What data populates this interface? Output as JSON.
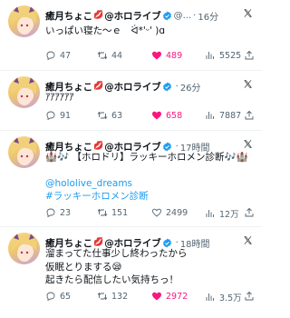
{
  "author": {
    "name": "癒月ちょこ",
    "org": "@ホロライブ",
    "lips": "💋"
  },
  "tweets": [
    {
      "handle": "@...",
      "time": "16分",
      "lines": [
        "いっぱい寝た〜ｅ　ᐛ*'ᵕ' )ɑ"
      ],
      "links": [],
      "replies": "47",
      "retweets": "44",
      "likes": "489",
      "views": "5525",
      "liked": true
    },
    {
      "handle": "",
      "time": "26分",
      "lines": [
        "ｱｱｱｱｱｱ"
      ],
      "links": [],
      "replies": "91",
      "retweets": "63",
      "likes": "658",
      "views": "7887",
      "liked": true
    },
    {
      "handle": "",
      "time": "17時間",
      "lines": [
        "🏰🎶 【ホロドリ】ラッキーホロメン診断🎶🏰"
      ],
      "links": [
        "@hololive_dreams",
        "#ラッキーホロメン診断"
      ],
      "replies": "23",
      "retweets": "151",
      "likes": "2499",
      "views": "12万",
      "liked": false
    },
    {
      "handle": "",
      "time": "18時間",
      "lines": [
        "溜まってた仕事少し終わったから",
        "仮眠とりまする😪",
        "起きたら配信したい気持ちっ！"
      ],
      "links": [],
      "replies": "65",
      "retweets": "132",
      "likes": "2972",
      "views": "3.5万",
      "liked": true
    }
  ],
  "icons": {
    "reply": "reply-icon",
    "retweet": "retweet-icon",
    "like": "heart-icon",
    "views": "views-icon",
    "share": "share-icon",
    "x": "x-logo-icon",
    "verified": "verified-badge-icon"
  },
  "colors": {
    "like": "#f91880",
    "link": "#1d9bf0",
    "verified": "#1d9bf0",
    "muted": "#536471"
  }
}
